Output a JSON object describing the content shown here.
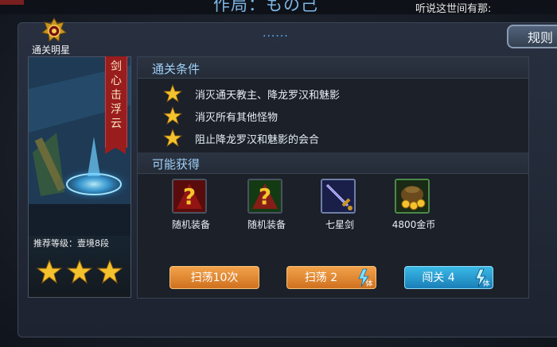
{
  "header": {
    "title": "作局：もの己",
    "rumor": "听说这世间有那:",
    "page_dots": "......",
    "rules_label": "规则"
  },
  "stage": {
    "badge_label": "通关明星",
    "name": "剑心击浮云",
    "recommended_level": "推荐等级：壹境8段",
    "stars_earned": 3,
    "stars_total": 3
  },
  "conditions": {
    "heading": "通关条件",
    "items": [
      "消灭通天教主、降龙罗汉和魅影",
      "消灭所有其他怪物",
      "阻止降龙罗汉和魅影的会合"
    ]
  },
  "rewards": {
    "heading": "可能获得",
    "items": [
      {
        "label": "随机装备",
        "icon": "random-equipment-icon"
      },
      {
        "label": "随机装备",
        "icon": "random-equipment-icon"
      },
      {
        "label": "七星剑",
        "icon": "seven-star-sword-icon"
      },
      {
        "label": "4800金币",
        "icon": "gold-coins-icon"
      }
    ]
  },
  "actions": {
    "sweep10_label": "扫荡10次",
    "sweep_label": "扫荡 2",
    "challenge_label": "闯关 4",
    "stamina_glyph": "体"
  },
  "colors": {
    "accent_blue": "#9fd0f7",
    "button_orange": "#d0711f",
    "button_blue": "#1a7fb8",
    "ribbon_red": "#9a1d1d",
    "star_gold": "#f4c22c"
  }
}
